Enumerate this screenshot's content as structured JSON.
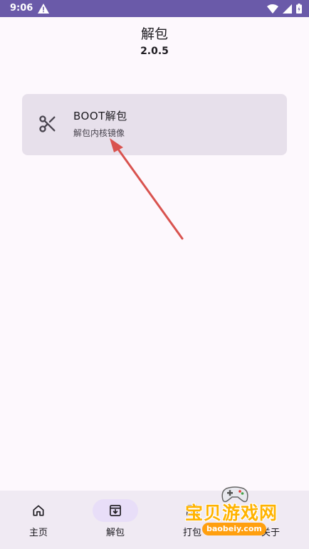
{
  "status_bar": {
    "time": "9:06",
    "icons": [
      "alert-triangle-icon",
      "wifi-icon",
      "cellular-signal-icon",
      "battery-icon"
    ],
    "color": "#6a5aa9"
  },
  "header": {
    "title": "解包",
    "version": "2.0.5"
  },
  "card": {
    "icon": "scissors-icon",
    "title": "BOOT解包",
    "subtitle": "解包内核镜像",
    "background": "#e7e0eb"
  },
  "annotation": {
    "type": "arrow",
    "color": "#d9534f"
  },
  "bottom_nav": {
    "items": [
      {
        "label": "主页",
        "icon": "home-icon",
        "active": false
      },
      {
        "label": "解包",
        "icon": "unpack-icon",
        "active": true
      },
      {
        "label": "打包",
        "icon": "pack-icon",
        "active": false
      },
      {
        "label": "关于",
        "icon": "info-icon",
        "active": false
      }
    ]
  },
  "watermark": {
    "text": "宝贝游戏网",
    "url": "baobeiy.com"
  }
}
